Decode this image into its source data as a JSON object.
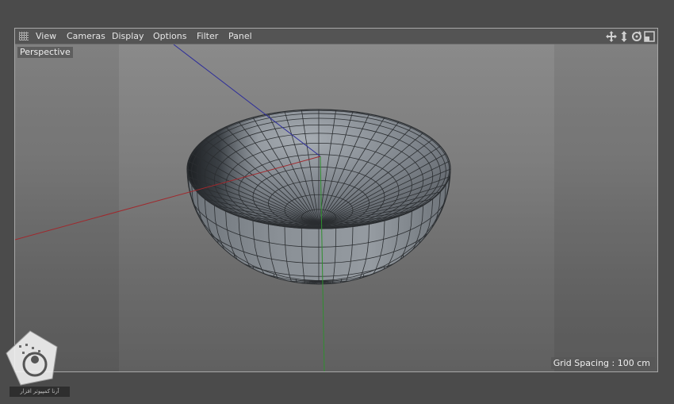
{
  "menubar": {
    "items": [
      {
        "label": "View"
      },
      {
        "label": "Cameras"
      },
      {
        "label": "Display"
      },
      {
        "label": "Options"
      },
      {
        "label": "Filter"
      },
      {
        "label": "Panel"
      }
    ],
    "nav_icons": [
      "move-view-icon",
      "zoom-view-icon",
      "rotate-view-icon",
      "toggle-layout-icon"
    ]
  },
  "viewport": {
    "camera_label": "Perspective",
    "grid_spacing": "Grid Spacing : 100 cm",
    "object": "hemisphere-bowl",
    "axis_colors": {
      "x": "#a0282c",
      "y": "#2f8f2f",
      "z": "#2e2e9a"
    }
  },
  "watermark": {
    "text": "آرنا کمپیوتر افزار"
  }
}
